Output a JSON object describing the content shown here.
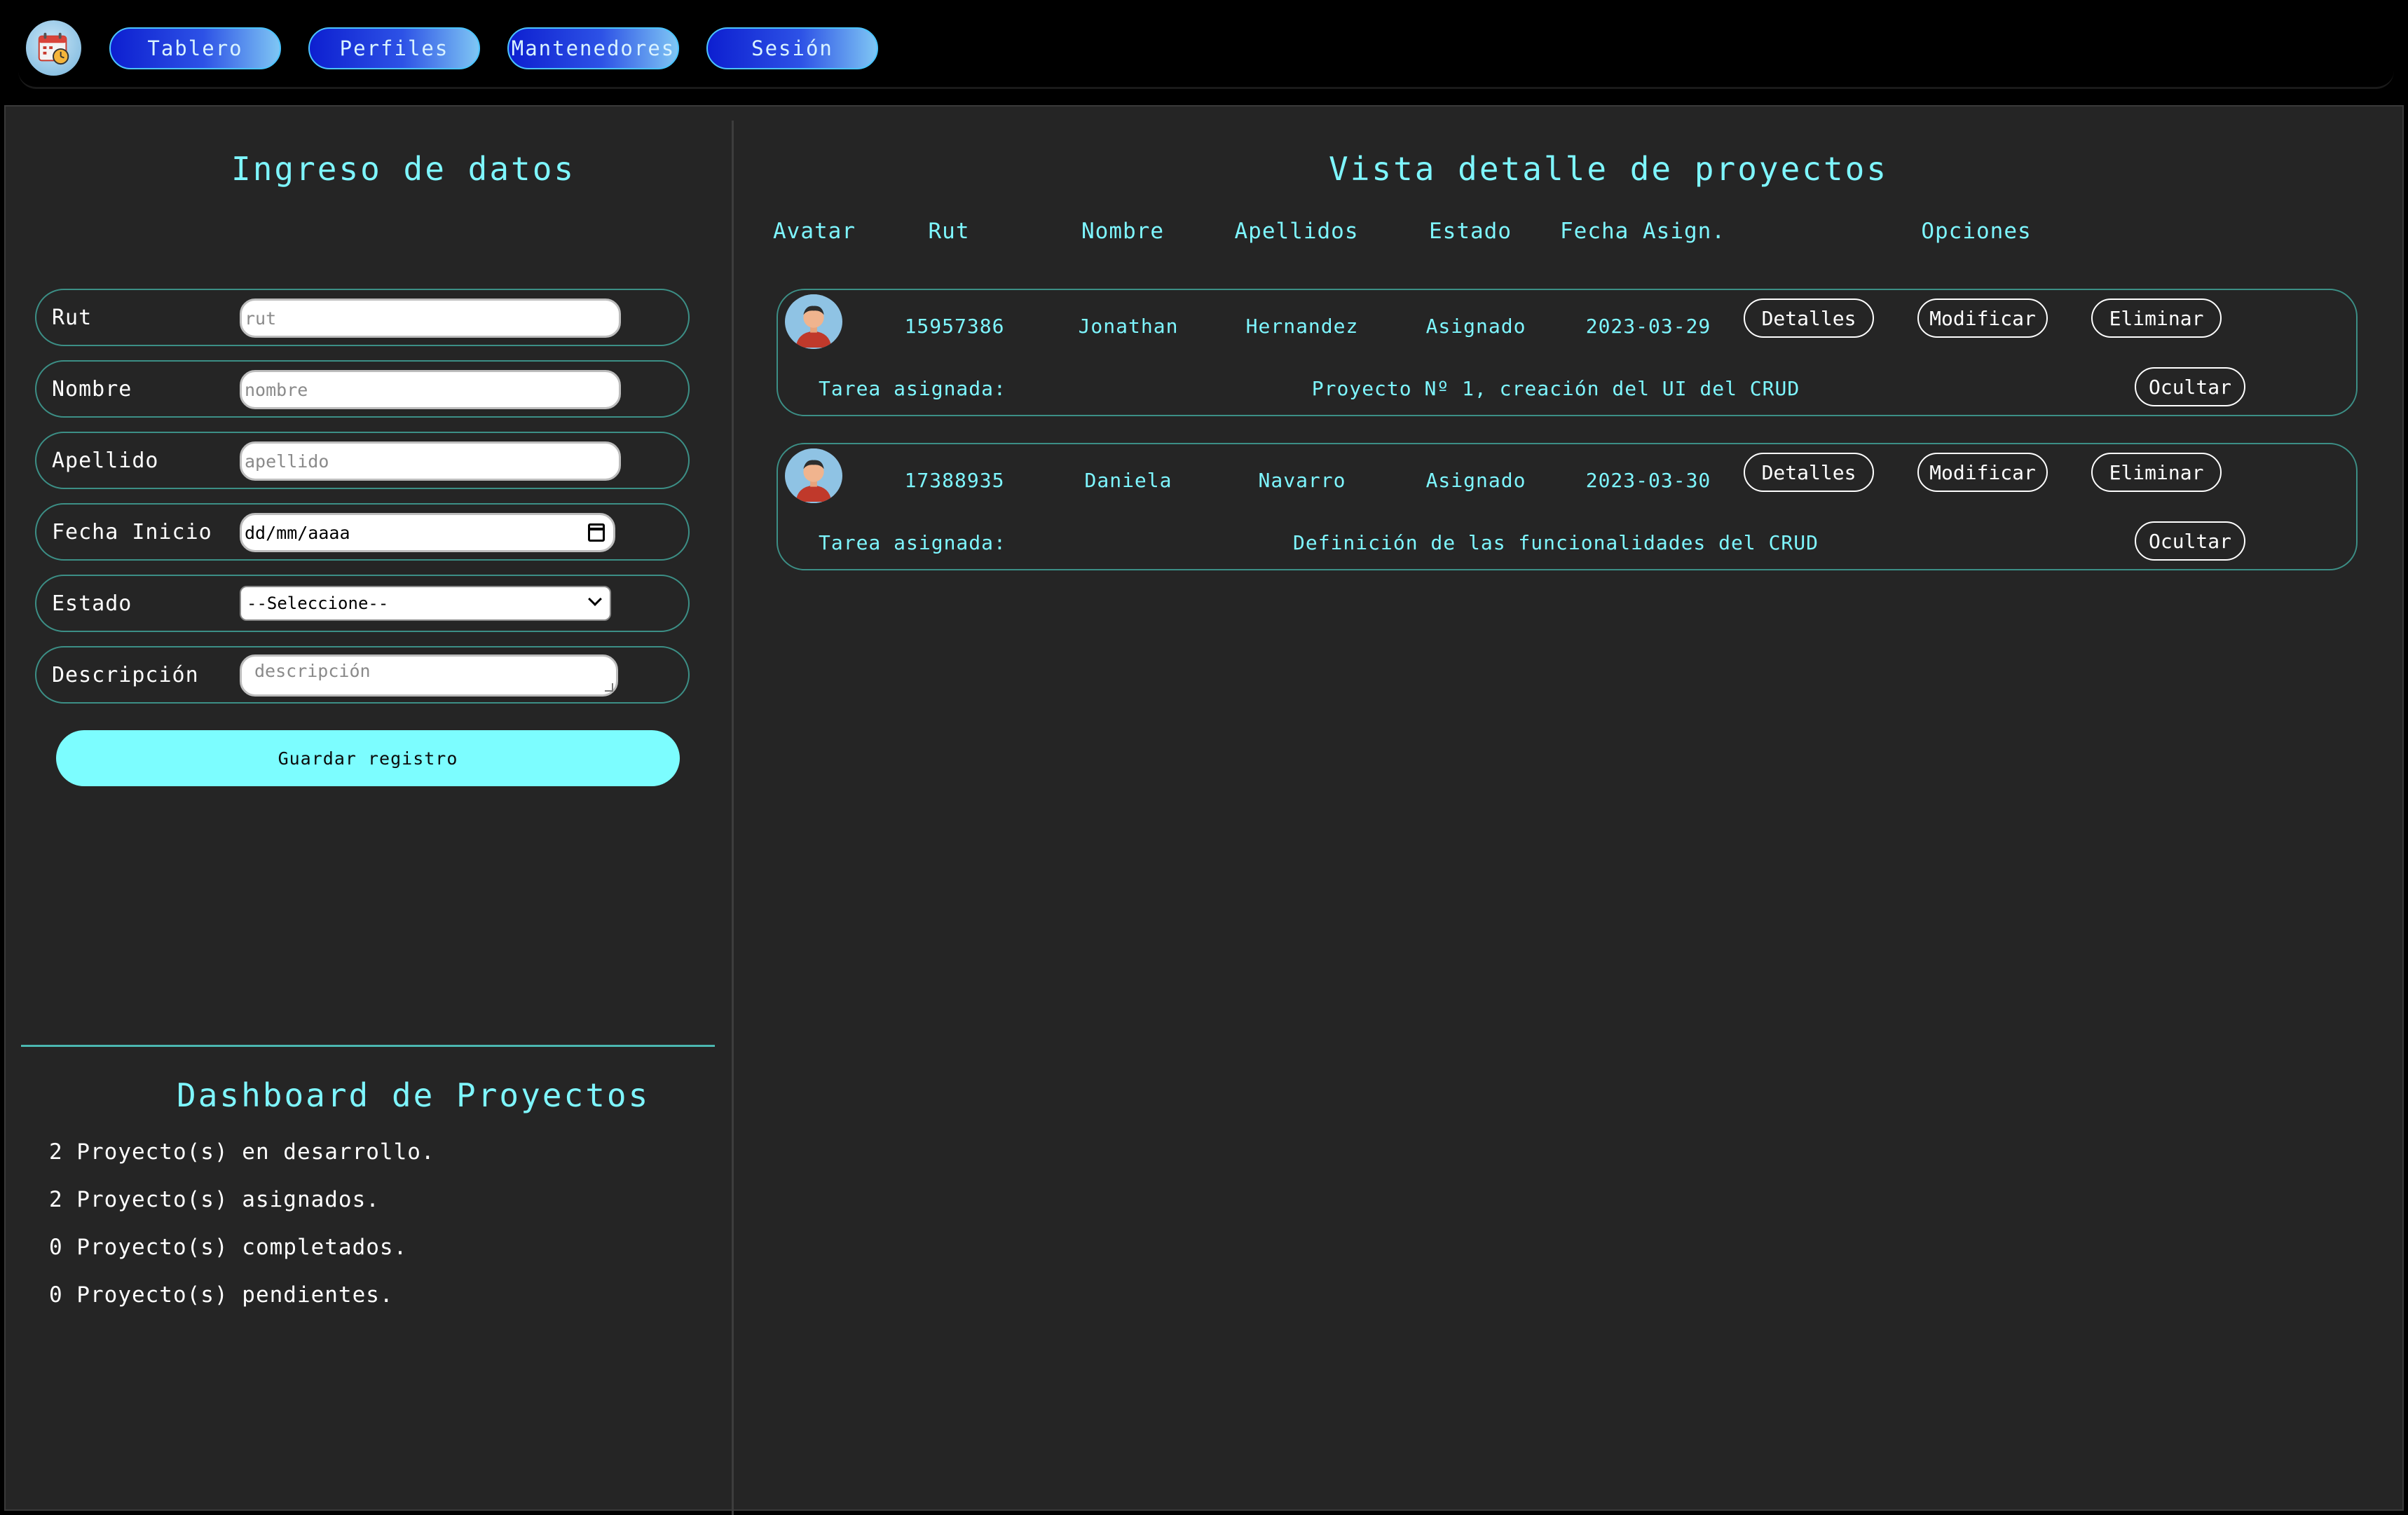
{
  "nav": {
    "logo_icon": "calendar-clock-icon",
    "buttons": [
      "Tablero",
      "Perfiles",
      "Mantenedores",
      "Sesión"
    ]
  },
  "form": {
    "title": "Ingreso de datos",
    "rut": {
      "label": "Rut",
      "placeholder": "rut"
    },
    "nombre": {
      "label": "Nombre",
      "placeholder": "nombre"
    },
    "apellido": {
      "label": "Apellido",
      "placeholder": "apellido"
    },
    "fecha": {
      "label": "Fecha Inicio",
      "value": "dd/mm/aaaa"
    },
    "estado": {
      "label": "Estado",
      "selected": "--Seleccione--"
    },
    "descripcion": {
      "label": "Descripción",
      "placeholder": "descripción"
    },
    "save_label": "Guardar registro"
  },
  "dashboard": {
    "title": "Dashboard de Proyectos",
    "lines": [
      "2 Proyecto(s) en desarrollo.",
      "2 Proyecto(s) asignados.",
      "0 Proyecto(s) completados.",
      "0 Proyecto(s) pendientes."
    ]
  },
  "detail": {
    "title": "Vista detalle de proyectos",
    "columns": [
      "Avatar",
      "Rut",
      "Nombre",
      "Apellidos",
      "Estado",
      "Fecha Asign.",
      "Opciones"
    ],
    "rows": [
      {
        "rut": "15957386",
        "nombre": "Jonathan",
        "apellidos": "Hernandez",
        "estado": "Asignado",
        "fecha": "2023-03-29",
        "task_label": "Tarea asignada:",
        "task": "Proyecto Nº 1, creación del UI del CRUD"
      },
      {
        "rut": "17388935",
        "nombre": "Daniela",
        "apellidos": "Navarro",
        "estado": "Asignado",
        "fecha": "2023-03-30",
        "task_label": "Tarea asignada:",
        "task": "Definición de las funcionalidades del CRUD"
      }
    ],
    "btn_details": "Detalles",
    "btn_modify": "Modificar",
    "btn_delete": "Eliminar",
    "btn_hide": "Ocultar"
  },
  "colors": {
    "accent": "#7ef6ff",
    "nav_gradient_start": "#0d1fd0",
    "panel_bg": "#252525",
    "border": "#3c8f86"
  }
}
